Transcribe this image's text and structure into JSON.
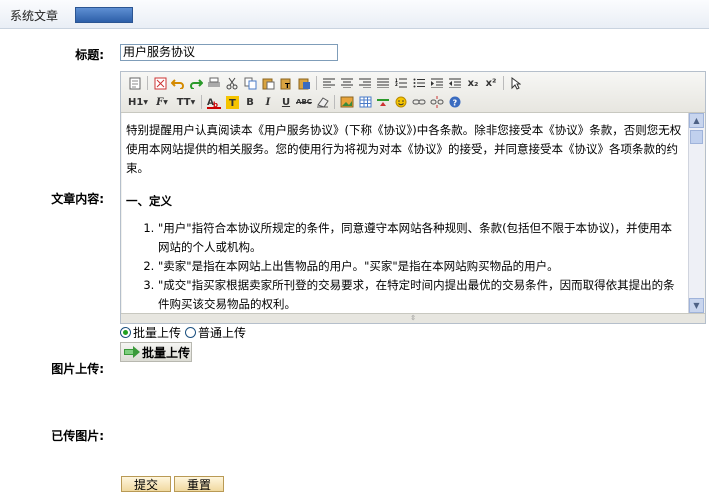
{
  "header": {
    "title": "系统文章"
  },
  "form": {
    "title_label": "标题:",
    "title_value": "用户服务协议",
    "content_label": "文章内容:",
    "image_label": "图片上传:",
    "uploaded_label": "已传图片:"
  },
  "editor": {
    "toolbar": {
      "heading": "H1",
      "font": "F",
      "size": "TT",
      "bold": "B",
      "italic": "I",
      "underline": "U",
      "strike": "ABC",
      "sub": "x₂",
      "sup": "x²"
    },
    "content": {
      "intro": "特别提醒用户认真阅读本《用户服务协议》(下称《协议》)中各条款。除非您接受本《协议》条款，否则您无权使用本网站提供的相关服务。您的使用行为将视为对本《协议》的接受，并同意接受本《协议》各项条款的约束。",
      "section_title": "一、定义",
      "items": [
        "\"用户\"指符合本协议所规定的条件，同意遵守本网站各种规则、条款(包括但不限于本协议)，并使用本网站的个人或机构。",
        "\"卖家\"是指在本网站上出售物品的用户。\"买家\"是指在本网站购买物品的用户。",
        "\"成交\"指买家根据卖家所刊登的交易要求，在特定时间内提出最优的交易条件，因而取得依其提出的条件购买该交易物品的权利。"
      ]
    }
  },
  "upload": {
    "option_batch": "批量上传",
    "option_normal": "普通上传",
    "selected": "批量上传",
    "batch_button": "批量上传"
  },
  "actions": {
    "submit": "提交",
    "reset": "重置"
  }
}
